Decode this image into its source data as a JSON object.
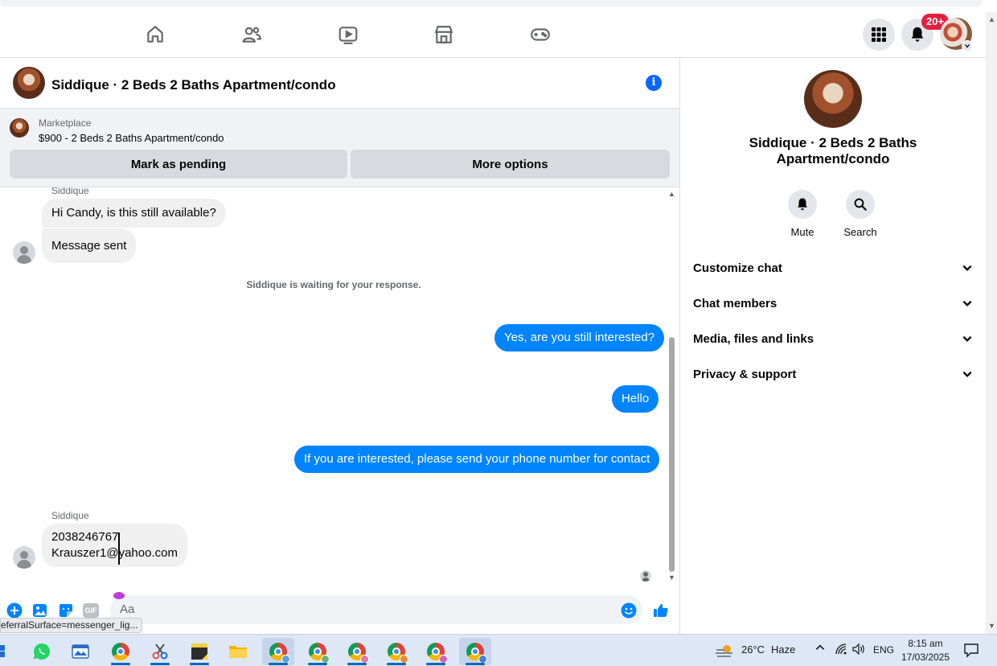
{
  "nav": {
    "notification_badge": "20+"
  },
  "chat": {
    "title": "Siddique · 2 Beds 2 Baths Apartment/condo",
    "info_icon_glyph": "i",
    "marketplace": {
      "label": "Marketplace",
      "item": "$900 - 2 Beds 2 Baths Apartment/condo",
      "pending_button": "Mark as pending",
      "more_button": "More options"
    },
    "messages": {
      "sender_top": "Siddique",
      "m1": "Hi Candy, is this still available?",
      "m2": "Message sent",
      "waiting": "Siddique is waiting for your response.",
      "out1": "Yes, are you still interested?",
      "out2": "Hello",
      "out3": "If you are interested, please send your phone number for contact",
      "sender_bottom": "Siddique",
      "phone": "2038246767",
      "email": "Krauszer1@yahoo.com"
    },
    "composer": {
      "placeholder": "Aa",
      "gif_label": "GIF"
    },
    "url_hint": "eferralSurface=messenger_lig..."
  },
  "info_panel": {
    "name_line1": "Siddique · 2 Beds 2 Baths",
    "name_line2": "Apartment/condo",
    "mute_label": "Mute",
    "search_label": "Search",
    "sections": [
      "Customize chat",
      "Chat members",
      "Media, files and links",
      "Privacy & support"
    ]
  },
  "taskbar": {
    "weather_temp": "26°C",
    "weather_desc": "Haze",
    "language": "ENG",
    "time": "8:15 am",
    "date": "17/03/2025"
  },
  "colors": {
    "accent": "#0084ff",
    "badge": "#e41e3f",
    "info": "#0866ff"
  }
}
